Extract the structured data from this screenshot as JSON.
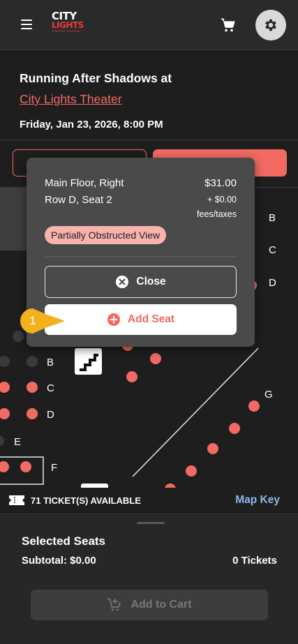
{
  "header": {
    "logo": {
      "line1": "CITY",
      "line2": "LIGHTS",
      "line3": "THEATER COMPANY"
    },
    "icons": [
      "menu-icon",
      "cart-icon",
      "gear-icon"
    ]
  },
  "event": {
    "title": "Running After Shadows at",
    "venue": "City Lights Theater",
    "datetime": "Friday, Jan 23, 2026, 8:00 PM"
  },
  "map": {
    "row_labels": [
      "B",
      "C",
      "D",
      "B",
      "C",
      "D",
      "E",
      "F",
      "G"
    ],
    "seat_colors": {
      "available": "#f26a62",
      "unavailable": "#3a3a3b"
    }
  },
  "popover": {
    "section": "Main Floor, Right",
    "seat": "Row D, Seat 2",
    "price": "$31.00",
    "fees_amount": "+ $0.00",
    "fees_label": "fees/taxes",
    "badge": "Partially Obstructed View",
    "close_label": "Close",
    "add_label": "Add Seat",
    "step_number": "1"
  },
  "tickets_bar": {
    "available_text": "71 TICKET(S) AVAILABLE",
    "map_key_label": "Map Key"
  },
  "sheet": {
    "title": "Selected Seats",
    "subtotal": "Subtotal: $0.00",
    "tickets": "0 Tickets",
    "cart_label": "Add to Cart"
  },
  "colors": {
    "accent": "#f26a62",
    "background": "#1e1e1f",
    "link_blue": "#8fb6e8",
    "step_badge": "#f2b21e"
  }
}
